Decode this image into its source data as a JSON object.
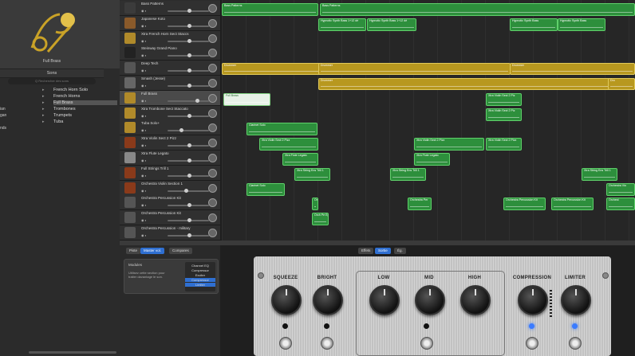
{
  "library": {
    "preview_name": "Full Brass",
    "header": "Sons",
    "search_placeholder": "Q  Rechercher des sons",
    "categories": [
      "",
      "",
      "ian",
      "gan",
      "",
      "nds"
    ],
    "subcategories": [
      "French Horn Solo",
      "French Horns",
      "Full Brass",
      "Trombones",
      "Trumpets",
      "Tuba"
    ],
    "selected_sub": "Full Brass"
  },
  "tracks": [
    {
      "name": "Bass Patterns",
      "icon": "bass-icon",
      "color": "#3b3b3b"
    },
    {
      "name": "Japanese Koto",
      "icon": "koto-icon",
      "color": "#8a5a2a"
    },
    {
      "name": "Xtra French Horn Sect Staccs",
      "icon": "horn-icon",
      "color": "#b08a2a"
    },
    {
      "name": "Steinway Grand Piano",
      "icon": "piano-icon",
      "color": "#222"
    },
    {
      "name": "Deep Tech",
      "icon": "drum-machine-icon",
      "color": "#555"
    },
    {
      "name": "Smash (Jesse)",
      "icon": "drum-kit-icon",
      "color": "#666"
    },
    {
      "name": "Full Brass",
      "icon": "trumpet-icon",
      "color": "#b08a2a"
    },
    {
      "name": "Xtra Trombone Sect Staccato",
      "icon": "trombone-icon",
      "color": "#b08a2a"
    },
    {
      "name": "Tuba Solo+",
      "icon": "tuba-icon",
      "color": "#b08a2a"
    },
    {
      "name": "Xtra Violin Sect 2 Pizz",
      "icon": "violin-section-icon",
      "color": "#8a3a1a"
    },
    {
      "name": "Xtra Flute Legato",
      "icon": "flute-icon",
      "color": "#888"
    },
    {
      "name": "Full Strings Trill 1",
      "icon": "strings-icon",
      "color": "#8a3a1a"
    },
    {
      "name": "Orchestra Violin Section 1",
      "icon": "violin-section-icon",
      "color": "#8a3a1a"
    },
    {
      "name": "Orchestra Percussion Kit",
      "icon": "percussion-icon",
      "color": "#555"
    },
    {
      "name": "Orchestra Percussion Kit",
      "icon": "percussion-icon",
      "color": "#555"
    },
    {
      "name": "Orchestra Percussion - military",
      "icon": "snare-icon",
      "color": "#555"
    }
  ],
  "regions": [
    {
      "row": 0,
      "label": "Bass Patterns",
      "kind": "g"
    },
    {
      "row": 0,
      "label": "Bass Patterns",
      "kind": "g"
    },
    {
      "row": 1,
      "label": "Hypnotic Synth Bass 1+12 dé",
      "kind": "g"
    },
    {
      "row": 1,
      "label": "Hypnotic Synth Bass 1+12 dé",
      "kind": "g"
    },
    {
      "row": 1,
      "label": "Hypnotic Synth Bass",
      "kind": "g"
    },
    {
      "row": 1,
      "label": "Hypnotic Synth Bass",
      "kind": "g"
    },
    {
      "row": 4,
      "label": "Drummer",
      "kind": "y"
    },
    {
      "row": 4,
      "label": "Drummer",
      "kind": "y"
    },
    {
      "row": 4,
      "label": "Drummer",
      "kind": "y"
    },
    {
      "row": 5,
      "label": "Drummer",
      "kind": "y"
    },
    {
      "row": 5,
      "label": "Dru",
      "kind": "y"
    },
    {
      "row": 6,
      "label": "Full Brass",
      "kind": "w"
    },
    {
      "row": 6,
      "label": "Xtra Violin Sect 2 Piz",
      "kind": "g"
    },
    {
      "row": 7,
      "label": "Xtra Violin Sect 2 Piz",
      "kind": "g"
    },
    {
      "row": 8,
      "label": "Clarinet Solo",
      "kind": "g"
    },
    {
      "row": 9,
      "label": "Xtra Violin Sect 2 Pizz",
      "kind": "g"
    },
    {
      "row": 9,
      "label": "Xtra Violin Sect 2 Pizz",
      "kind": "g"
    },
    {
      "row": 9,
      "label": "Xtra Violin Sect 2 Pizz",
      "kind": "g"
    },
    {
      "row": 10,
      "label": "Xtra Flute Legato",
      "kind": "g"
    },
    {
      "row": 10,
      "label": "Xtra Flute Legato",
      "kind": "g"
    },
    {
      "row": 11,
      "label": "Xtra String Ens Trill 1",
      "kind": "g"
    },
    {
      "row": 11,
      "label": "Xtra String Ens Trill 1",
      "kind": "g"
    },
    {
      "row": 11,
      "label": "Xtra String Ens Trill 1",
      "kind": "g"
    },
    {
      "row": 12,
      "label": "Clarinet Solo",
      "kind": "g"
    },
    {
      "row": 12,
      "label": "Orchestra Vio",
      "kind": "g"
    },
    {
      "row": 13,
      "label": "Or",
      "kind": "g"
    },
    {
      "row": 13,
      "label": "Orchestra Per",
      "kind": "g"
    },
    {
      "row": 13,
      "label": "Orchestra Percussion Kit",
      "kind": "g"
    },
    {
      "row": 13,
      "label": "Orchestra Percussion Kit",
      "kind": "g"
    },
    {
      "row": 13,
      "label": "Orchest",
      "kind": "g"
    },
    {
      "row": 14,
      "label": "Orch Pe Ep",
      "kind": "g"
    }
  ],
  "bottom": {
    "tabs_left": [
      "Piste",
      "Master vol.",
      "Compares"
    ],
    "tabs_right": [
      "Effets",
      "Sortie",
      "Ég."
    ],
    "module_title": "Modules",
    "module_desc": "Utilisez cette section pour traiter davantage le son.",
    "plugins": [
      "Channel EQ",
      "Compressor",
      "Exciter",
      "Compressor",
      "Limiter"
    ],
    "amp_labels": [
      "SQUEEZE",
      "BRIGHT",
      "LOW",
      "MID",
      "HIGH",
      "COMPRESSION",
      "LIMITER"
    ]
  }
}
